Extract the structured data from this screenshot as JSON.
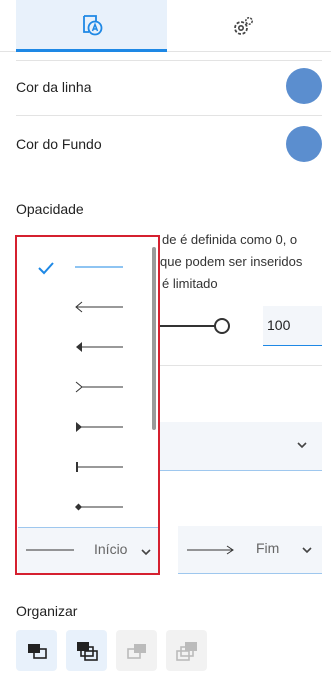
{
  "tabs": {
    "style": {
      "icon": "shape-text-icon",
      "selected": true
    },
    "settings": {
      "icon": "gear-icon"
    }
  },
  "line_color": {
    "label": "Cor da linha",
    "color": "#5b8ecf"
  },
  "background_color": {
    "label": "Cor do Fundo",
    "color": "#5b8ecf"
  },
  "opacity": {
    "title": "Opacidade",
    "description_line1": "de é definida como 0, o",
    "description_line2": "que podem ser inseridos",
    "description_line3": "é limitado",
    "value": "100",
    "slider_level": 1.0
  },
  "arrow_start": {
    "label": "Início",
    "options": [
      "none",
      "open-arrow",
      "filled-arrow",
      "chevron-arrow",
      "filled-triangle",
      "bar",
      "diamond"
    ],
    "selected": "none"
  },
  "arrow_end": {
    "label": "Fim"
  },
  "organize": {
    "title": "Organizar",
    "buttons": [
      {
        "icon": "bring-forward-icon",
        "enabled": true
      },
      {
        "icon": "bring-to-front-icon",
        "enabled": true
      },
      {
        "icon": "send-backward-icon",
        "enabled": false
      },
      {
        "icon": "send-to-back-icon",
        "enabled": false
      }
    ]
  },
  "colors": {
    "accent": "#1e88e5",
    "highlight_border": "#d5202f",
    "swatch": "#5b8ecf"
  }
}
